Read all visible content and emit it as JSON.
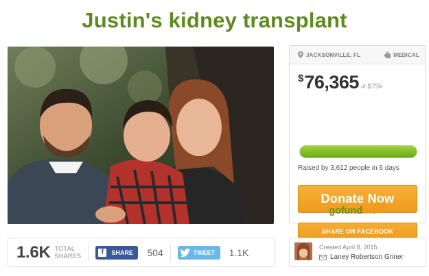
{
  "campaign": {
    "title": "Justin's kidney transplant"
  },
  "card": {
    "location": "JACKSONVILLE, FL",
    "category": "MEDICAL",
    "amount_symbol": "$",
    "amount": "76,365",
    "goal_prefix": "of",
    "goal": "$75k",
    "progress_fraction": 1.0,
    "raised_text": "Raised by 3,612 people in 6 days",
    "donate_label": "Donate Now",
    "share_facebook_label": "SHARE ON FACEBOOK",
    "brand_go": "gofund",
    "brand_me": "me"
  },
  "sharebar": {
    "total_shares": "1.6K",
    "total_label_1": "TOTAL",
    "total_label_2": "SHARES",
    "facebook_label": "SHARE",
    "facebook_count": "504",
    "twitter_label": "TWEET",
    "twitter_count": "1.1K"
  },
  "organizer": {
    "created": "Created April 8, 2015",
    "name": "Laney Robertson Griner"
  },
  "colors": {
    "title_green": "#5e8a1f",
    "donate_orange": "#f0a028",
    "progress_green": "#7fbf28",
    "facebook_blue": "#3b5998",
    "twitter_blue": "#69b7e6"
  },
  "icons": {
    "location": "map-pin-icon",
    "category": "tag-icon",
    "facebook": "facebook-icon",
    "twitter": "twitter-icon",
    "mail": "mail-icon"
  }
}
